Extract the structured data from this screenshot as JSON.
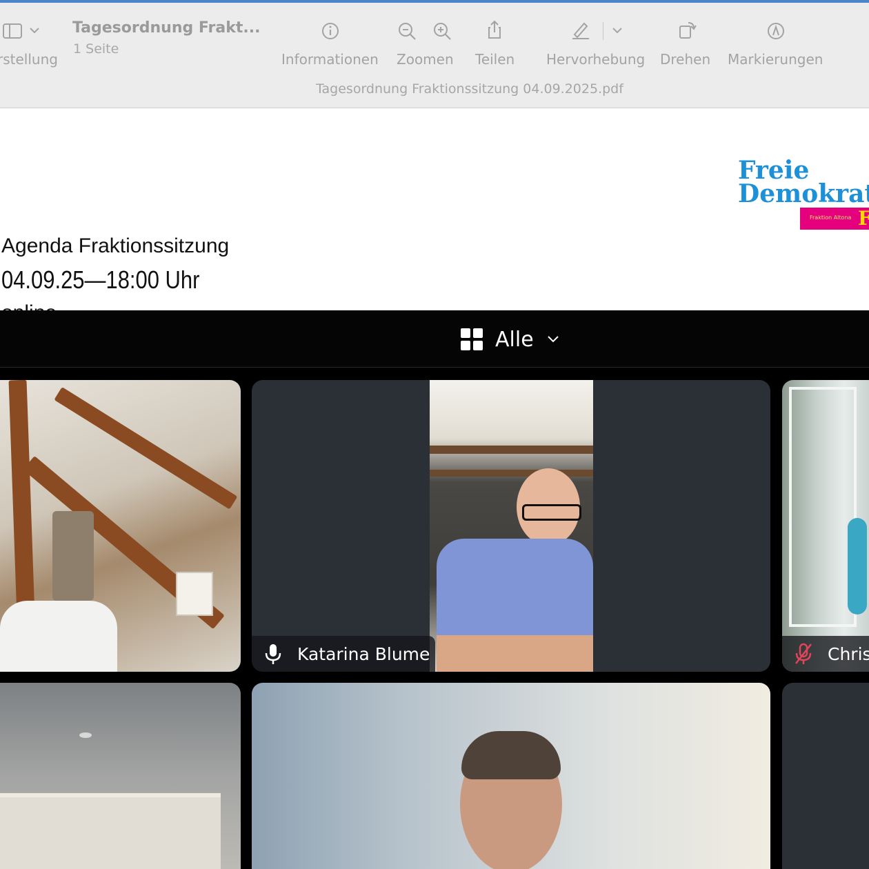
{
  "toolbar": {
    "view_label": "rstellung",
    "doc_title": "Tagesordnung  Frakt...",
    "doc_pages": "1 Seite",
    "info_label": "Informationen",
    "zoom_label": "Zoomen",
    "share_label": "Teilen",
    "highlight_label": "Hervorhebung",
    "rotate_label": "Drehen",
    "markup_label": "Markierungen",
    "file_name": "Tagesordnung  Fraktionssitzung 04.09.2025.pdf"
  },
  "pdf": {
    "logo_line1": "Freie",
    "logo_line2": "Demokraten",
    "logo_bar_small": "Fraktion Altona",
    "logo_bar_big": "FDP",
    "agenda_title": "Agenda Fraktionssitzung",
    "agenda_datetime": "04.09.25—18:00 Uhr",
    "agenda_location": "online"
  },
  "meeting": {
    "view_mode_label": "Alle",
    "participants": [
      {
        "name": "Katarina Blume",
        "mic": "on"
      },
      {
        "name": "Chris",
        "mic": "muted"
      }
    ]
  },
  "colors": {
    "toolbar_bg": "#ececec",
    "logo_blue": "#1e90d8",
    "logo_magenta": "#e5007d",
    "logo_yellow": "#ffd800",
    "tile_bg": "#2b2f36",
    "muted_red": "#e0455a"
  }
}
